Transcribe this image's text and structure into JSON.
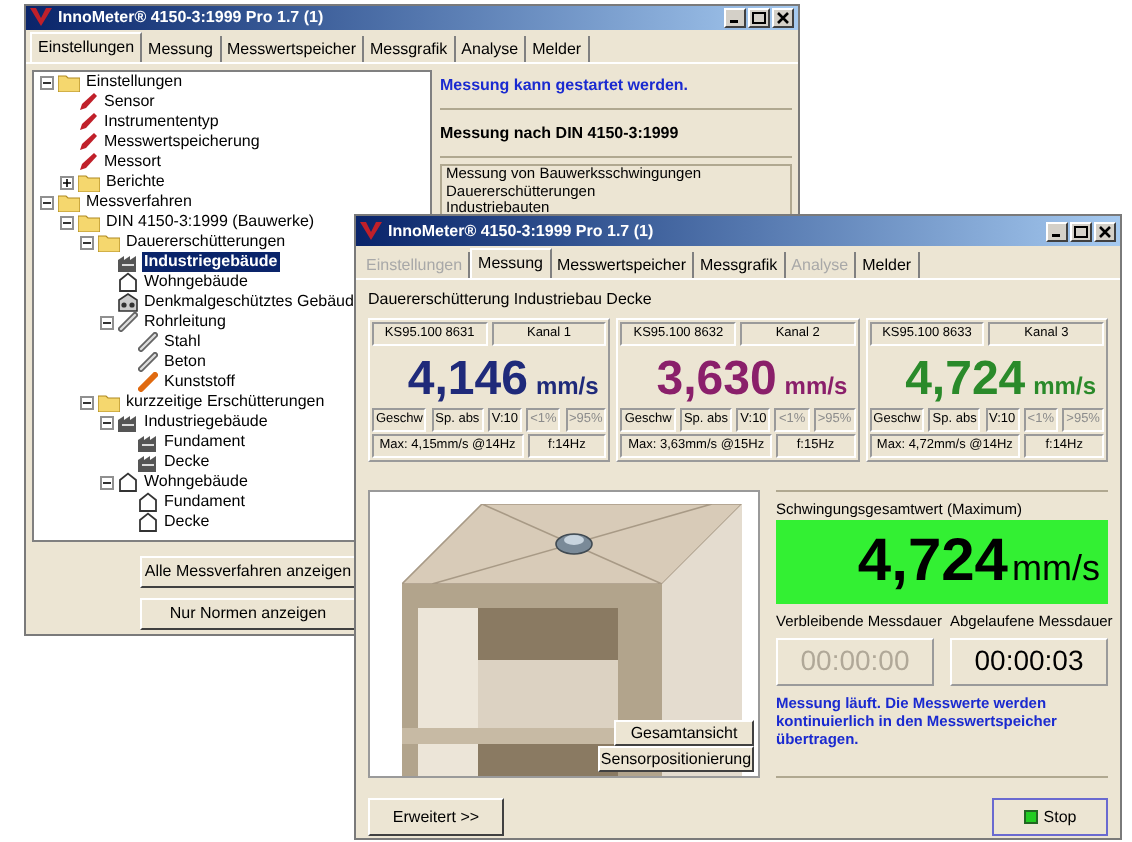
{
  "back_window": {
    "title": "InnoMeter® 4150-3:1999 Pro 1.7 (1)",
    "tabs": [
      {
        "label": "Einstellungen",
        "selected": true
      },
      {
        "label": "Messung",
        "selected": false
      },
      {
        "label": "Messwertspeicher",
        "selected": false
      },
      {
        "label": "Messgrafik",
        "selected": false
      },
      {
        "label": "Analyse",
        "selected": false
      },
      {
        "label": "Melder",
        "selected": false
      }
    ],
    "tree": [
      {
        "label": "Einstellungen",
        "kind": "folder",
        "expanded": true,
        "selected": false,
        "children": [
          {
            "label": "Sensor",
            "kind": "pencil",
            "selected": false
          },
          {
            "label": "Instrumententyp",
            "kind": "pencil",
            "selected": false
          },
          {
            "label": "Messwertspeicherung",
            "kind": "pencil",
            "selected": false
          },
          {
            "label": "Messort",
            "kind": "pencil",
            "selected": false
          },
          {
            "label": "Berichte",
            "kind": "folder",
            "expanded": false,
            "selected": false
          }
        ]
      },
      {
        "label": "Messverfahren",
        "kind": "folder",
        "expanded": true,
        "selected": false,
        "children": [
          {
            "label": "DIN 4150-3:1999 (Bauwerke)",
            "kind": "folder",
            "expanded": true,
            "selected": false,
            "children": [
              {
                "label": "Dauererschütterungen",
                "kind": "folder",
                "expanded": true,
                "selected": false,
                "children": [
                  {
                    "label": "Industriegebäude",
                    "kind": "factory",
                    "selected": true
                  },
                  {
                    "label": "Wohngebäude",
                    "kind": "house",
                    "selected": false
                  },
                  {
                    "label": "Denkmalgeschütztes Gebäud",
                    "kind": "monument",
                    "selected": false
                  },
                  {
                    "label": "Rohrleitung",
                    "kind": "pipe",
                    "expanded": true,
                    "selected": false,
                    "children": [
                      {
                        "label": "Stahl",
                        "kind": "pipe",
                        "selected": false
                      },
                      {
                        "label": "Beton",
                        "kind": "pipe",
                        "selected": false
                      },
                      {
                        "label": "Kunststoff",
                        "kind": "pipe-orange",
                        "selected": false
                      }
                    ]
                  }
                ]
              },
              {
                "label": "kurzzeitige Erschütterungen",
                "kind": "folder",
                "expanded": true,
                "selected": false,
                "children": [
                  {
                    "label": "Industriegebäude",
                    "kind": "factory",
                    "expanded": true,
                    "selected": false,
                    "children": [
                      {
                        "label": "Fundament",
                        "kind": "factory",
                        "selected": false
                      },
                      {
                        "label": "Decke",
                        "kind": "factory",
                        "selected": false
                      }
                    ]
                  },
                  {
                    "label": "Wohngebäude",
                    "kind": "house",
                    "expanded": true,
                    "selected": false,
                    "children": [
                      {
                        "label": "Fundament",
                        "kind": "house",
                        "selected": false
                      },
                      {
                        "label": "Decke",
                        "kind": "house",
                        "selected": false
                      }
                    ]
                  }
                ]
              }
            ]
          }
        ]
      }
    ],
    "buttons": [
      "Alle Messverfahren anzeigen",
      "Nur Normen anzeigen"
    ],
    "status": "Messung kann gestartet werden.",
    "heading": "Messung nach DIN 4150-3:1999",
    "description": [
      "Messung von Bauwerksschwingungen",
      "Dauererschütterungen",
      "Industriebauten"
    ]
  },
  "front_window": {
    "title": "InnoMeter® 4150-3:1999 Pro 1.7 (1)",
    "tabs": [
      {
        "label": "Einstellungen",
        "selected": false,
        "disabled": true
      },
      {
        "label": "Messung",
        "selected": true,
        "disabled": false
      },
      {
        "label": "Messwertspeicher",
        "selected": false,
        "disabled": false
      },
      {
        "label": "Messgrafik",
        "selected": false,
        "disabled": false
      },
      {
        "label": "Analyse",
        "selected": false,
        "disabled": true
      },
      {
        "label": "Melder",
        "selected": false,
        "disabled": false
      }
    ],
    "subtitle": "Dauererschütterung Industriebau Decke",
    "channels": [
      {
        "serial": "KS95.100 8631",
        "name": "Kanal 1",
        "value": "4,146",
        "unit": "mm/s",
        "color": "#1f2a7a",
        "flags": [
          "Geschw",
          "Sp. abs",
          "V:10"
        ],
        "limits": [
          "<1%",
          ">95%"
        ],
        "max": "Max: 4,15mm/s @14Hz",
        "freq": "f:14Hz"
      },
      {
        "serial": "KS95.100 8632",
        "name": "Kanal 2",
        "value": "3,630",
        "unit": "mm/s",
        "color": "#8a1f6a",
        "flags": [
          "Geschw",
          "Sp. abs",
          "V:10"
        ],
        "limits": [
          "<1%",
          ">95%"
        ],
        "max": "Max: 3,63mm/s @15Hz",
        "freq": "f:15Hz"
      },
      {
        "serial": "KS95.100 8633",
        "name": "Kanal 3",
        "value": "4,724",
        "unit": "mm/s",
        "color": "#2a8a2a",
        "flags": [
          "Geschw",
          "Sp. abs",
          "V:10"
        ],
        "limits": [
          "<1%",
          ">95%"
        ],
        "max": "Max: 4,72mm/s @14Hz",
        "freq": "f:14Hz"
      }
    ],
    "view_buttons": [
      "Gesamtansicht",
      "Sensorpositionierung"
    ],
    "total_label": "Schwingungsgesamtwert (Maximum)",
    "total_value": "4,724",
    "total_unit": "mm/s",
    "timers": [
      {
        "label": "Verbleibende Messdauer",
        "value": "00:00:00",
        "disabled": true
      },
      {
        "label": "Abgelaufene Messdauer",
        "value": "00:00:03",
        "disabled": false
      }
    ],
    "message": "Messung läuft. Die Messwerte werden kontinuierlich in den Messwertspeicher übertragen.",
    "extended_button": "Erweitert >>",
    "stop_button": "Stop"
  }
}
